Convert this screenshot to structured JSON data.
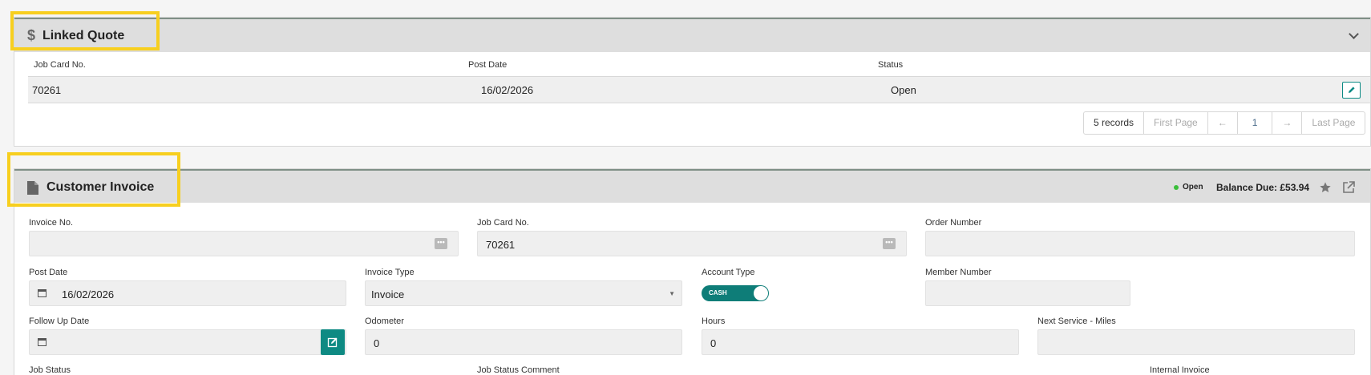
{
  "linked_quote": {
    "title": "Linked Quote",
    "columns": [
      "Job Card No.",
      "Post Date",
      "Status"
    ],
    "rows": [
      {
        "job_card_no": "70261",
        "post_date": "16/02/2026",
        "status": "Open"
      }
    ],
    "pager": {
      "records": "5 records",
      "first": "First Page",
      "prev": "←",
      "page": "1",
      "next": "→",
      "last": "Last Page"
    }
  },
  "customer_invoice": {
    "title": "Customer Invoice",
    "status": "Open",
    "balance_due": "Balance Due: £53.94",
    "fields": {
      "invoice_no": {
        "label": "Invoice No.",
        "value": ""
      },
      "job_card_no": {
        "label": "Job Card No.",
        "value": "70261"
      },
      "order_number": {
        "label": "Order Number",
        "value": ""
      },
      "post_date": {
        "label": "Post Date",
        "value": "16/02/2026"
      },
      "invoice_type": {
        "label": "Invoice Type",
        "value": "Invoice"
      },
      "account_type": {
        "label": "Account Type",
        "value": "CASH"
      },
      "member_number": {
        "label": "Member Number",
        "value": ""
      },
      "follow_up_date": {
        "label": "Follow Up Date",
        "value": ""
      },
      "odometer": {
        "label": "Odometer",
        "value": "0"
      },
      "hours": {
        "label": "Hours",
        "value": "0"
      },
      "next_service_miles": {
        "label": "Next Service - Miles",
        "value": ""
      },
      "job_status": {
        "label": "Job Status"
      },
      "job_status_comment": {
        "label": "Job Status Comment"
      },
      "internal_invoice": {
        "label": "Internal Invoice"
      }
    }
  },
  "colors": {
    "accent": "#0e7d78",
    "highlight": "#f7cf1f",
    "status_open": "#3bbf3b"
  }
}
